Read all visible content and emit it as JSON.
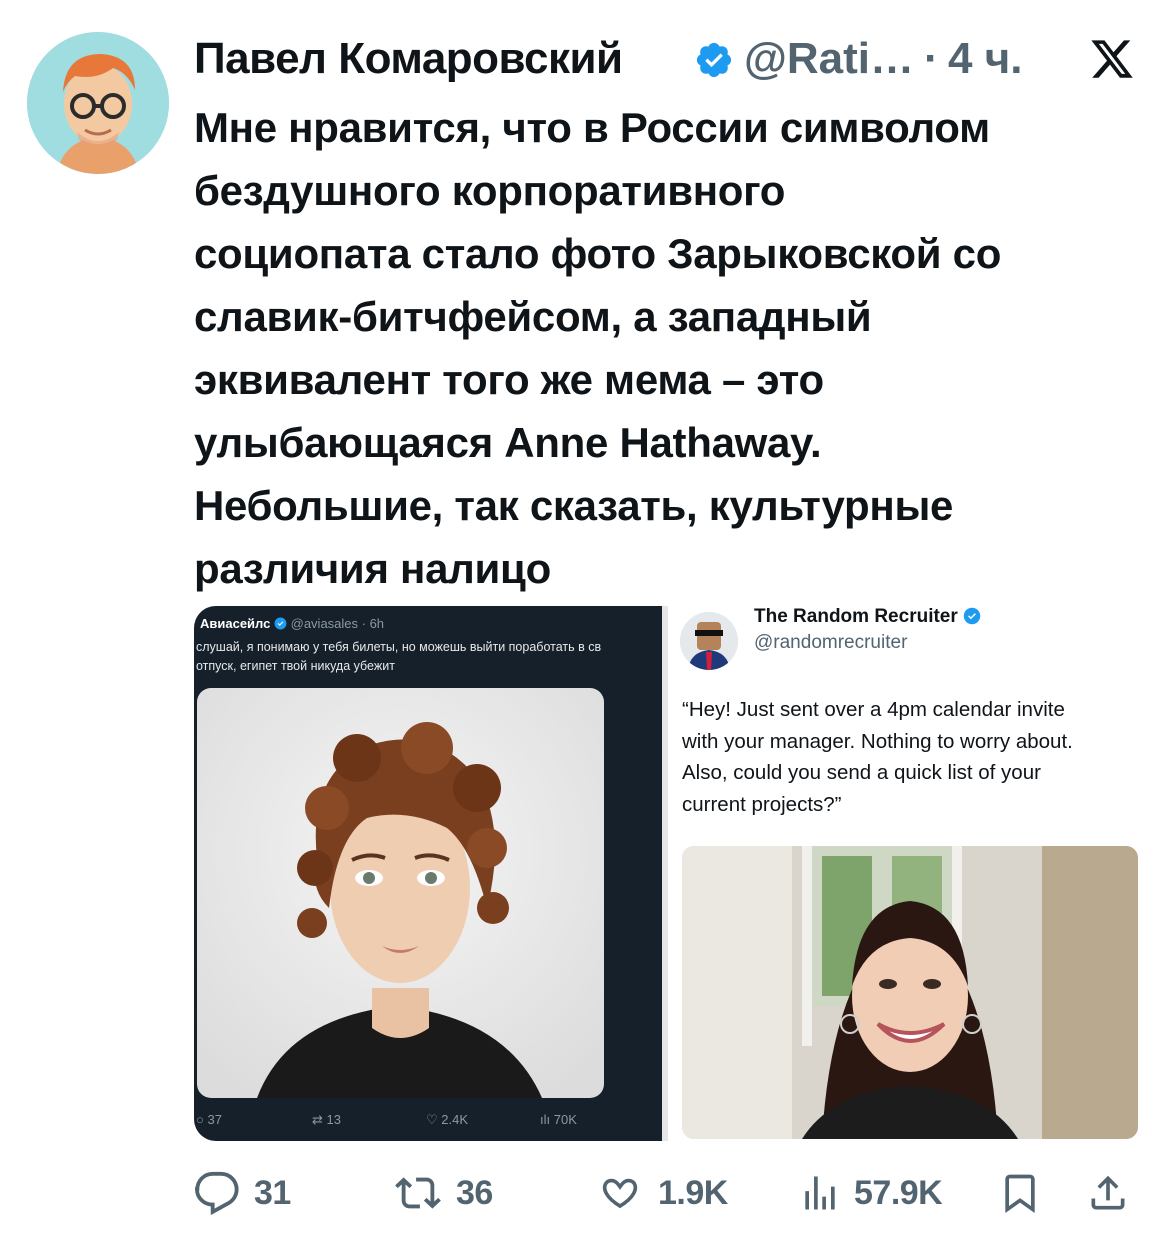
{
  "author": {
    "name": "Павел Комаровский",
    "handle": "@Rati…",
    "separator": "·",
    "time": "4 ч."
  },
  "post": {
    "text": "Мне нравится, что в России символом\nбездушного корпоративного\nсоциопата стало фото Зарыковской со\nславик-битчфейсом, а западный\nэквивалент того же мема – это\nулыбающаяся Anne Hathaway.\nНебольшие, так сказать, культурные\nразличия налицо"
  },
  "embedded_left": {
    "name": "Авиасейлс",
    "handle": "@aviasales · 6h",
    "text": "слушай, я понимаю у тебя билеты, но можешь выйти поработать в св\nотпуск, египет твой никуда убежит",
    "stats": {
      "replies": "37",
      "reposts": "13",
      "likes": "2.4K",
      "views": "70K"
    }
  },
  "embedded_right": {
    "name": "The Random Recruiter",
    "handle": "@randomrecruiter",
    "text": "“Hey! Just sent over a 4pm calendar invite\nwith your manager. Nothing to worry about.\nAlso, could you send a quick list of your\ncurrent projects?”"
  },
  "actions": {
    "replies": "31",
    "reposts": "36",
    "likes": "1.9K",
    "views": "57.9K"
  },
  "colors": {
    "verified": "#1d9bf0",
    "muted": "#536471",
    "text": "#0f1419",
    "dark_panel": "#15202b"
  },
  "icons": [
    "x-logo-icon",
    "verified-badge-icon",
    "reply-icon",
    "repost-icon",
    "like-icon",
    "views-icon",
    "bookmark-icon",
    "share-icon"
  ]
}
